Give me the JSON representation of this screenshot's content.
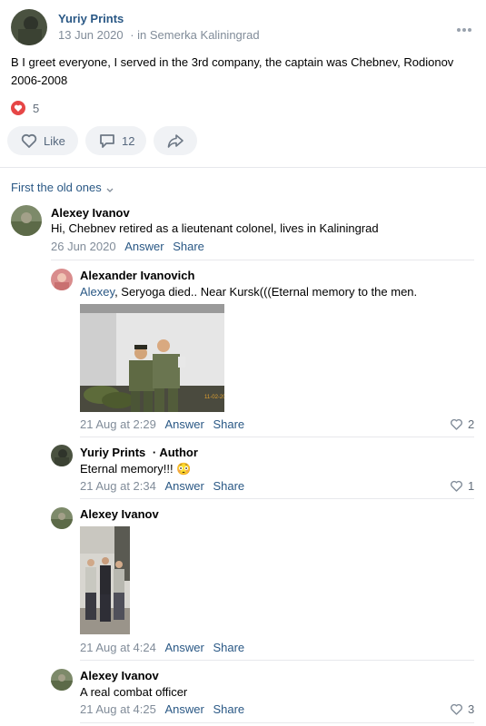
{
  "post": {
    "author": "Yuriy Prints",
    "date": "13 Jun 2020",
    "location_prefix": "· in",
    "location": "Semerka Kaliningrad",
    "text_line1": "B I greet everyone, I served in the 3rd company, the captain was Chebnev, Rodionov",
    "text_line2": "2006-2008",
    "reactions_count": "5",
    "like_label": "Like",
    "comments_count": "12",
    "more_icon": "more-dots-icon"
  },
  "sort_label": "First the old ones",
  "comments": [
    {
      "author": "Alexey Ivanov",
      "text": "Hi, Chebnev retired as a lieutenant colonel, lives in Kaliningrad",
      "date": "26 Jun 2020",
      "answer": "Answer",
      "share": "Share"
    },
    {
      "author": "Alexander Ivanovich",
      "mention": "Alexey",
      "text": ", Seryoga died.. Near Kursk(((Eternal memory to the men.",
      "date": "21 Aug at 2:29",
      "answer": "Answer",
      "share": "Share",
      "likes": "2"
    },
    {
      "author": "Yuriy Prints",
      "badge": "·  Author",
      "text": "Eternal memory!!! 😳",
      "date": "21 Aug at 2:34",
      "answer": "Answer",
      "share": "Share",
      "likes": "1"
    },
    {
      "author": "Alexey Ivanov",
      "date": "21 Aug at 4:24",
      "answer": "Answer",
      "share": "Share"
    },
    {
      "author": "Alexey Ivanov",
      "text": "A real combat officer",
      "date": "21 Aug at 4:25",
      "answer": "Answer",
      "share": "Share",
      "likes": "3"
    }
  ],
  "photo_caption": "11-02-2006",
  "colors": {
    "link": "#2a5885",
    "meta": "#818c99",
    "pill_bg": "#f0f2f5",
    "heart": "#e64646"
  }
}
